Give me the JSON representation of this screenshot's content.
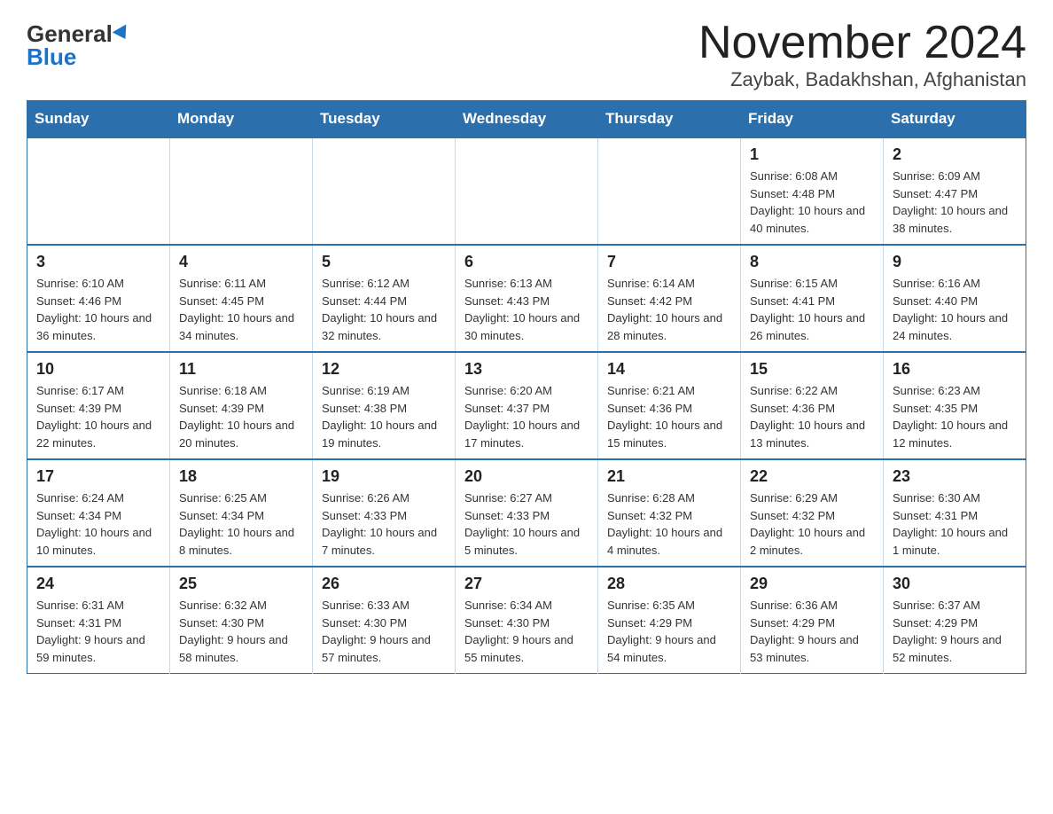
{
  "header": {
    "logo_general": "General",
    "logo_blue": "Blue",
    "title": "November 2024",
    "subtitle": "Zaybak, Badakhshan, Afghanistan"
  },
  "calendar": {
    "days_of_week": [
      "Sunday",
      "Monday",
      "Tuesday",
      "Wednesday",
      "Thursday",
      "Friday",
      "Saturday"
    ],
    "weeks": [
      [
        {
          "day": "",
          "info": ""
        },
        {
          "day": "",
          "info": ""
        },
        {
          "day": "",
          "info": ""
        },
        {
          "day": "",
          "info": ""
        },
        {
          "day": "",
          "info": ""
        },
        {
          "day": "1",
          "info": "Sunrise: 6:08 AM\nSunset: 4:48 PM\nDaylight: 10 hours and 40 minutes."
        },
        {
          "day": "2",
          "info": "Sunrise: 6:09 AM\nSunset: 4:47 PM\nDaylight: 10 hours and 38 minutes."
        }
      ],
      [
        {
          "day": "3",
          "info": "Sunrise: 6:10 AM\nSunset: 4:46 PM\nDaylight: 10 hours and 36 minutes."
        },
        {
          "day": "4",
          "info": "Sunrise: 6:11 AM\nSunset: 4:45 PM\nDaylight: 10 hours and 34 minutes."
        },
        {
          "day": "5",
          "info": "Sunrise: 6:12 AM\nSunset: 4:44 PM\nDaylight: 10 hours and 32 minutes."
        },
        {
          "day": "6",
          "info": "Sunrise: 6:13 AM\nSunset: 4:43 PM\nDaylight: 10 hours and 30 minutes."
        },
        {
          "day": "7",
          "info": "Sunrise: 6:14 AM\nSunset: 4:42 PM\nDaylight: 10 hours and 28 minutes."
        },
        {
          "day": "8",
          "info": "Sunrise: 6:15 AM\nSunset: 4:41 PM\nDaylight: 10 hours and 26 minutes."
        },
        {
          "day": "9",
          "info": "Sunrise: 6:16 AM\nSunset: 4:40 PM\nDaylight: 10 hours and 24 minutes."
        }
      ],
      [
        {
          "day": "10",
          "info": "Sunrise: 6:17 AM\nSunset: 4:39 PM\nDaylight: 10 hours and 22 minutes."
        },
        {
          "day": "11",
          "info": "Sunrise: 6:18 AM\nSunset: 4:39 PM\nDaylight: 10 hours and 20 minutes."
        },
        {
          "day": "12",
          "info": "Sunrise: 6:19 AM\nSunset: 4:38 PM\nDaylight: 10 hours and 19 minutes."
        },
        {
          "day": "13",
          "info": "Sunrise: 6:20 AM\nSunset: 4:37 PM\nDaylight: 10 hours and 17 minutes."
        },
        {
          "day": "14",
          "info": "Sunrise: 6:21 AM\nSunset: 4:36 PM\nDaylight: 10 hours and 15 minutes."
        },
        {
          "day": "15",
          "info": "Sunrise: 6:22 AM\nSunset: 4:36 PM\nDaylight: 10 hours and 13 minutes."
        },
        {
          "day": "16",
          "info": "Sunrise: 6:23 AM\nSunset: 4:35 PM\nDaylight: 10 hours and 12 minutes."
        }
      ],
      [
        {
          "day": "17",
          "info": "Sunrise: 6:24 AM\nSunset: 4:34 PM\nDaylight: 10 hours and 10 minutes."
        },
        {
          "day": "18",
          "info": "Sunrise: 6:25 AM\nSunset: 4:34 PM\nDaylight: 10 hours and 8 minutes."
        },
        {
          "day": "19",
          "info": "Sunrise: 6:26 AM\nSunset: 4:33 PM\nDaylight: 10 hours and 7 minutes."
        },
        {
          "day": "20",
          "info": "Sunrise: 6:27 AM\nSunset: 4:33 PM\nDaylight: 10 hours and 5 minutes."
        },
        {
          "day": "21",
          "info": "Sunrise: 6:28 AM\nSunset: 4:32 PM\nDaylight: 10 hours and 4 minutes."
        },
        {
          "day": "22",
          "info": "Sunrise: 6:29 AM\nSunset: 4:32 PM\nDaylight: 10 hours and 2 minutes."
        },
        {
          "day": "23",
          "info": "Sunrise: 6:30 AM\nSunset: 4:31 PM\nDaylight: 10 hours and 1 minute."
        }
      ],
      [
        {
          "day": "24",
          "info": "Sunrise: 6:31 AM\nSunset: 4:31 PM\nDaylight: 9 hours and 59 minutes."
        },
        {
          "day": "25",
          "info": "Sunrise: 6:32 AM\nSunset: 4:30 PM\nDaylight: 9 hours and 58 minutes."
        },
        {
          "day": "26",
          "info": "Sunrise: 6:33 AM\nSunset: 4:30 PM\nDaylight: 9 hours and 57 minutes."
        },
        {
          "day": "27",
          "info": "Sunrise: 6:34 AM\nSunset: 4:30 PM\nDaylight: 9 hours and 55 minutes."
        },
        {
          "day": "28",
          "info": "Sunrise: 6:35 AM\nSunset: 4:29 PM\nDaylight: 9 hours and 54 minutes."
        },
        {
          "day": "29",
          "info": "Sunrise: 6:36 AM\nSunset: 4:29 PM\nDaylight: 9 hours and 53 minutes."
        },
        {
          "day": "30",
          "info": "Sunrise: 6:37 AM\nSunset: 4:29 PM\nDaylight: 9 hours and 52 minutes."
        }
      ]
    ]
  }
}
